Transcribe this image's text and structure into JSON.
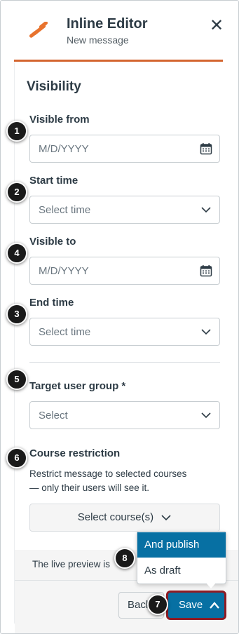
{
  "header": {
    "title": "Inline Editor",
    "subtitle": "New message",
    "close_icon": "close-icon",
    "accent_color": "#d4652f"
  },
  "section_title": "Visibility",
  "fields": {
    "visible_from": {
      "label": "Visible from",
      "placeholder": "M/D/YYYY",
      "icon": "calendar-icon",
      "callout": "1"
    },
    "start_time": {
      "label": "Start time",
      "placeholder": "Select time",
      "icon": "chevron-down-icon",
      "callout": "2"
    },
    "visible_to": {
      "label": "Visible to",
      "placeholder": "M/D/YYYY",
      "icon": "calendar-icon",
      "callout": "4"
    },
    "end_time": {
      "label": "End time",
      "placeholder": "Select time",
      "icon": "chevron-down-icon",
      "callout": "3"
    },
    "target_group": {
      "label": "Target user group *",
      "placeholder": "Select",
      "icon": "chevron-down-icon",
      "callout": "5"
    },
    "course_restriction": {
      "label": "Course restriction",
      "description_line1": "Restrict message to selected courses",
      "description_line2": "— only their users will see it.",
      "button_label": "Select course(s)",
      "callout": "6"
    }
  },
  "footer": {
    "preview_text": "The live preview is",
    "back_label": "Back",
    "save_label": "Save",
    "save_callout": "7",
    "save_color": "#0770a3"
  },
  "save_menu": {
    "callout": "8",
    "items": [
      {
        "label": "And publish",
        "active": true
      },
      {
        "label": "As draft",
        "active": false
      }
    ]
  }
}
